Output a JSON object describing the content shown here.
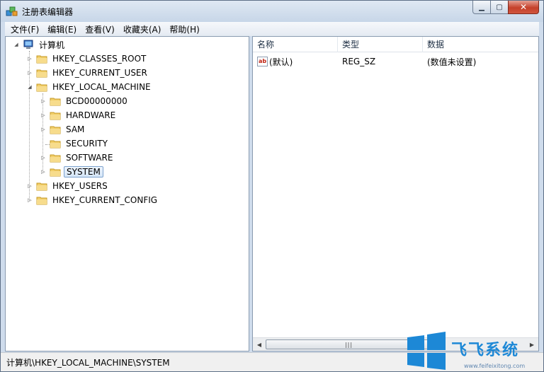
{
  "window": {
    "title": "注册表编辑器"
  },
  "menu": [
    "文件(F)",
    "编辑(E)",
    "查看(V)",
    "收藏夹(A)",
    "帮助(H)"
  ],
  "tree": {
    "root": "计算机",
    "hives": [
      {
        "label": "HKEY_CLASSES_ROOT"
      },
      {
        "label": "HKEY_CURRENT_USER"
      },
      {
        "label": "HKEY_LOCAL_MACHINE",
        "children": [
          "BCD00000000",
          "HARDWARE",
          "SAM",
          "SECURITY",
          "SOFTWARE",
          "SYSTEM"
        ]
      },
      {
        "label": "HKEY_USERS"
      },
      {
        "label": "HKEY_CURRENT_CONFIG"
      }
    ],
    "selected": "SYSTEM"
  },
  "list": {
    "columns": [
      "名称",
      "类型",
      "数据"
    ],
    "rows": [
      {
        "name": "(默认)",
        "type": "REG_SZ",
        "data": "(数值未设置)"
      }
    ]
  },
  "status": "计算机\\HKEY_LOCAL_MACHINE\\SYSTEM",
  "watermark": {
    "text": "飞飞系统",
    "url": "www.feifeixitong.com"
  },
  "colors": {
    "accent": "#1d88d6",
    "selection": "#d6e7f8",
    "close": "#c5402a"
  },
  "icons": {
    "app": "regedit-icon",
    "folder": "folder-icon",
    "computer": "computer-icon",
    "value": "string-value-icon"
  }
}
